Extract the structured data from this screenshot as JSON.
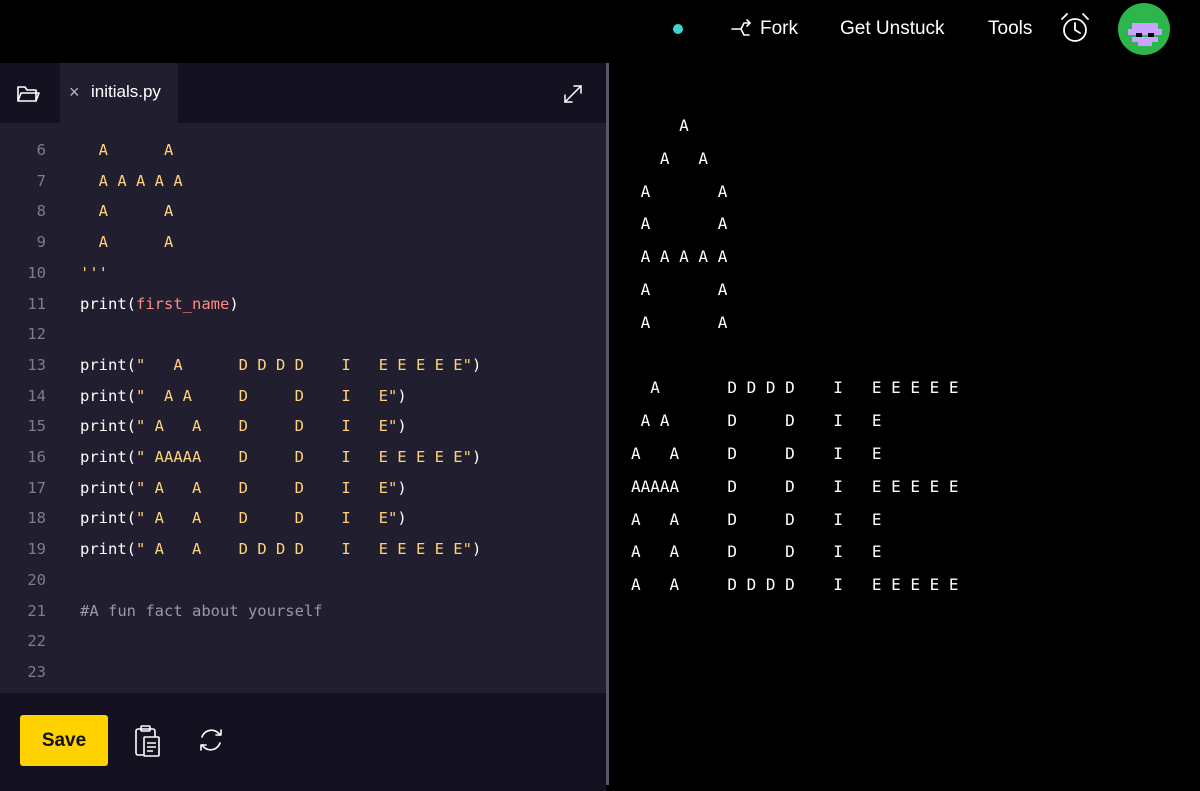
{
  "header": {
    "fork_label": "Fork",
    "get_unstuck_label": "Get Unstuck",
    "tools_label": "Tools",
    "status_color": "#3ad6cf"
  },
  "editor": {
    "tab_name": "initials.py",
    "tab_close": "×",
    "lines": [
      {
        "n": "6",
        "segments": [
          {
            "t": "  A      A",
            "c": "str"
          }
        ]
      },
      {
        "n": "7",
        "segments": [
          {
            "t": "  A A A A A",
            "c": "str"
          }
        ]
      },
      {
        "n": "8",
        "segments": [
          {
            "t": "  A      A",
            "c": "str"
          }
        ]
      },
      {
        "n": "9",
        "segments": [
          {
            "t": "  A      A",
            "c": "str"
          }
        ]
      },
      {
        "n": "10",
        "segments": [
          {
            "t": "'''",
            "c": "str"
          }
        ]
      },
      {
        "n": "11",
        "segments": [
          {
            "t": "print",
            "c": "fn"
          },
          {
            "t": "(",
            "c": "pun"
          },
          {
            "t": "first_name",
            "c": "var"
          },
          {
            "t": ")",
            "c": "pun"
          }
        ]
      },
      {
        "n": "12",
        "segments": []
      },
      {
        "n": "13",
        "segments": [
          {
            "t": "print",
            "c": "fn"
          },
          {
            "t": "(",
            "c": "pun"
          },
          {
            "t": "\"   A      D D D D    I   E E E E E\"",
            "c": "str"
          },
          {
            "t": ")",
            "c": "pun"
          }
        ]
      },
      {
        "n": "14",
        "segments": [
          {
            "t": "print",
            "c": "fn"
          },
          {
            "t": "(",
            "c": "pun"
          },
          {
            "t": "\"  A A     D     D    I   E\"",
            "c": "str"
          },
          {
            "t": ")",
            "c": "pun"
          }
        ]
      },
      {
        "n": "15",
        "segments": [
          {
            "t": "print",
            "c": "fn"
          },
          {
            "t": "(",
            "c": "pun"
          },
          {
            "t": "\" A   A    D     D    I   E\"",
            "c": "str"
          },
          {
            "t": ")",
            "c": "pun"
          }
        ]
      },
      {
        "n": "16",
        "segments": [
          {
            "t": "print",
            "c": "fn"
          },
          {
            "t": "(",
            "c": "pun"
          },
          {
            "t": "\" AAAAA    D     D    I   E E E E E\"",
            "c": "str"
          },
          {
            "t": ")",
            "c": "pun"
          }
        ]
      },
      {
        "n": "17",
        "segments": [
          {
            "t": "print",
            "c": "fn"
          },
          {
            "t": "(",
            "c": "pun"
          },
          {
            "t": "\" A   A    D     D    I   E\"",
            "c": "str"
          },
          {
            "t": ")",
            "c": "pun"
          }
        ]
      },
      {
        "n": "18",
        "segments": [
          {
            "t": "print",
            "c": "fn"
          },
          {
            "t": "(",
            "c": "pun"
          },
          {
            "t": "\" A   A    D     D    I   E\"",
            "c": "str"
          },
          {
            "t": ")",
            "c": "pun"
          }
        ]
      },
      {
        "n": "19",
        "segments": [
          {
            "t": "print",
            "c": "fn"
          },
          {
            "t": "(",
            "c": "pun"
          },
          {
            "t": "\" A   A    D D D D    I   E E E E E\"",
            "c": "str"
          },
          {
            "t": ")",
            "c": "pun"
          }
        ]
      },
      {
        "n": "20",
        "segments": []
      },
      {
        "n": "21",
        "segments": [
          {
            "t": "#A fun fact about yourself",
            "c": "com"
          }
        ]
      },
      {
        "n": "22",
        "segments": []
      },
      {
        "n": "23",
        "segments": []
      }
    ]
  },
  "footer": {
    "save_label": "Save"
  },
  "output": {
    "lines": [
      "     A",
      "   A   A",
      " A       A",
      " A       A",
      " A A A A A",
      " A       A",
      " A       A",
      "",
      "  A       D D D D    I   E E E E E",
      " A A      D     D    I   E",
      "A   A     D     D    I   E",
      "AAAAA     D     D    I   E E E E E",
      "A   A     D     D    I   E",
      "A   A     D     D    I   E",
      "A   A     D D D D    I   E E E E E"
    ]
  }
}
